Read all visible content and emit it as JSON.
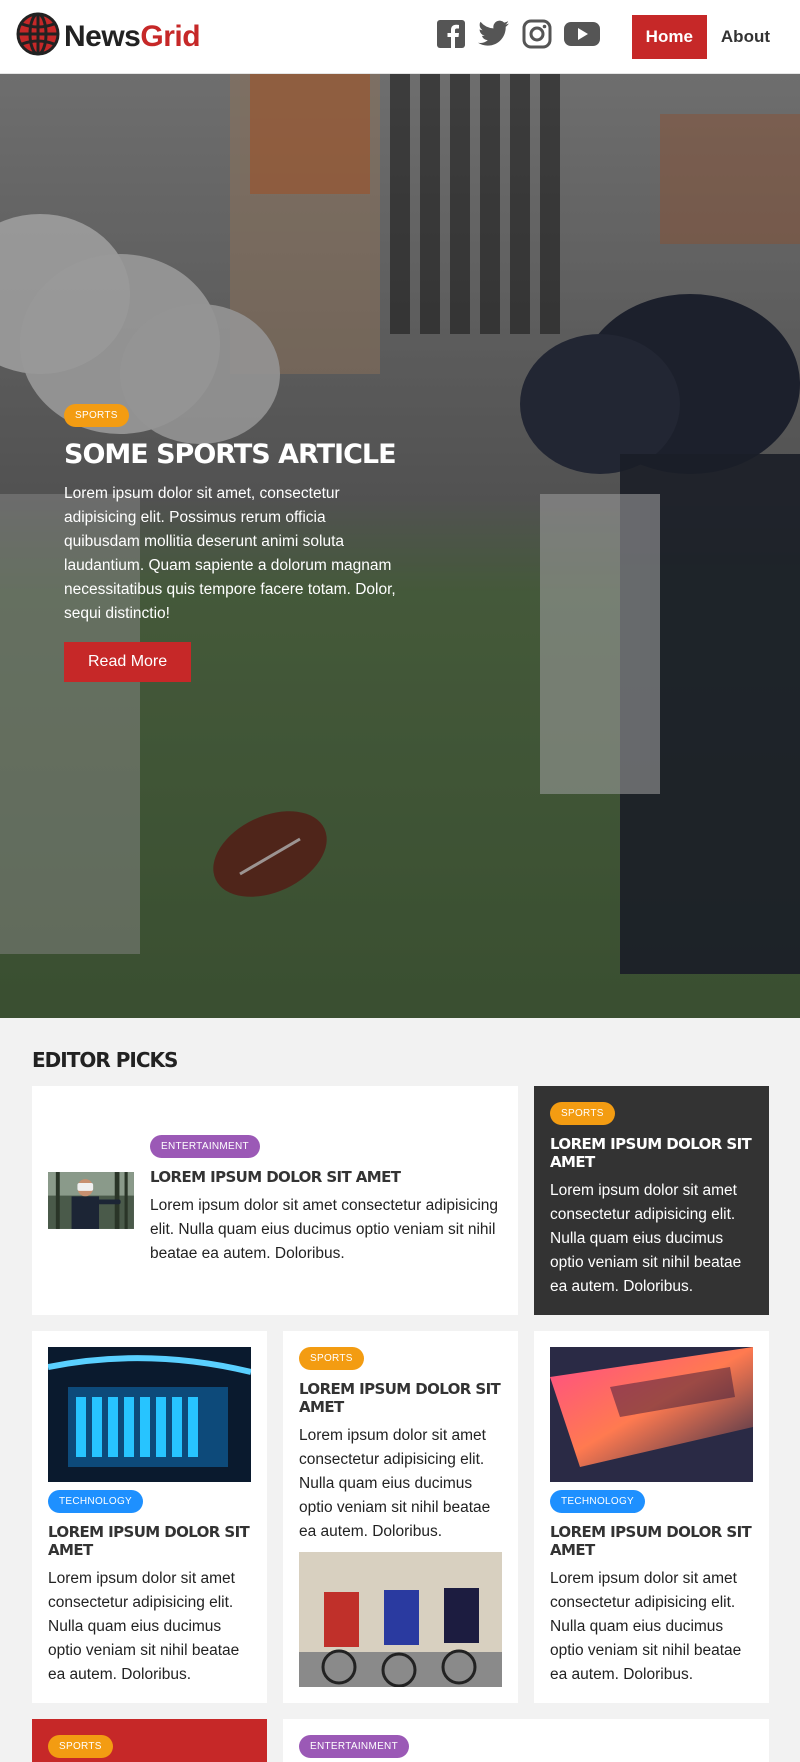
{
  "header": {
    "logo_main": "News",
    "logo_accent": "Grid",
    "social": [
      "facebook-icon",
      "twitter-icon",
      "instagram-icon",
      "youtube-icon"
    ],
    "nav": {
      "home": "Home",
      "about": "About"
    }
  },
  "hero": {
    "badge": "Sports",
    "title": "Some Sports Article",
    "text": "Lorem ipsum dolor sit amet, consectetur adipisicing elit. Possimus rerum officia quibusdam mollitia deserunt animi soluta laudantium. Quam sapiente a dolorum magnam necessitatibus quis tempore facere totam. Dolor, sequi distinctio!",
    "button": "Read More"
  },
  "picks": {
    "title": "Editor Picks",
    "cards": [
      {
        "badge": "Entertainment",
        "title": "Lorem ipsum dolor sit amet",
        "text": "Lorem ipsum dolor sit amet consectetur adipisicing elit. Nulla quam eius ducimus optio veniam sit nihil beatae ea autem. Doloribus."
      },
      {
        "badge": "Sports",
        "title": "Lorem ipsum dolor sit amet",
        "text": "Lorem ipsum dolor sit amet consectetur adipisicing elit. Nulla quam eius ducimus optio veniam sit nihil beatae ea autem. Doloribus."
      },
      {
        "badge": "Technology",
        "title": "Lorem ipsum dolor sit amet",
        "text": "Lorem ipsum dolor sit amet consectetur adipisicing elit. Nulla quam eius ducimus optio veniam sit nihil beatae ea autem. Doloribus."
      },
      {
        "badge": "Sports",
        "title": "Lorem ipsum dolor sit amet",
        "text": "Lorem ipsum dolor sit amet consectetur adipisicing elit. Nulla quam eius ducimus optio veniam sit nihil beatae ea autem. Doloribus."
      },
      {
        "badge": "Technology",
        "title": "Lorem ipsum dolor sit amet",
        "text": "Lorem ipsum dolor sit amet consectetur adipisicing elit. Nulla quam eius ducimus optio veniam sit nihil beatae ea autem. Doloribus."
      },
      {
        "badge": "Sports"
      },
      {
        "badge": "Entertainment"
      }
    ]
  },
  "colors": {
    "brand_red": "#c62828",
    "sports": "#f39c12",
    "entertainment": "#9b59b6",
    "technology": "#1e90ff",
    "dark_card": "#333333"
  }
}
